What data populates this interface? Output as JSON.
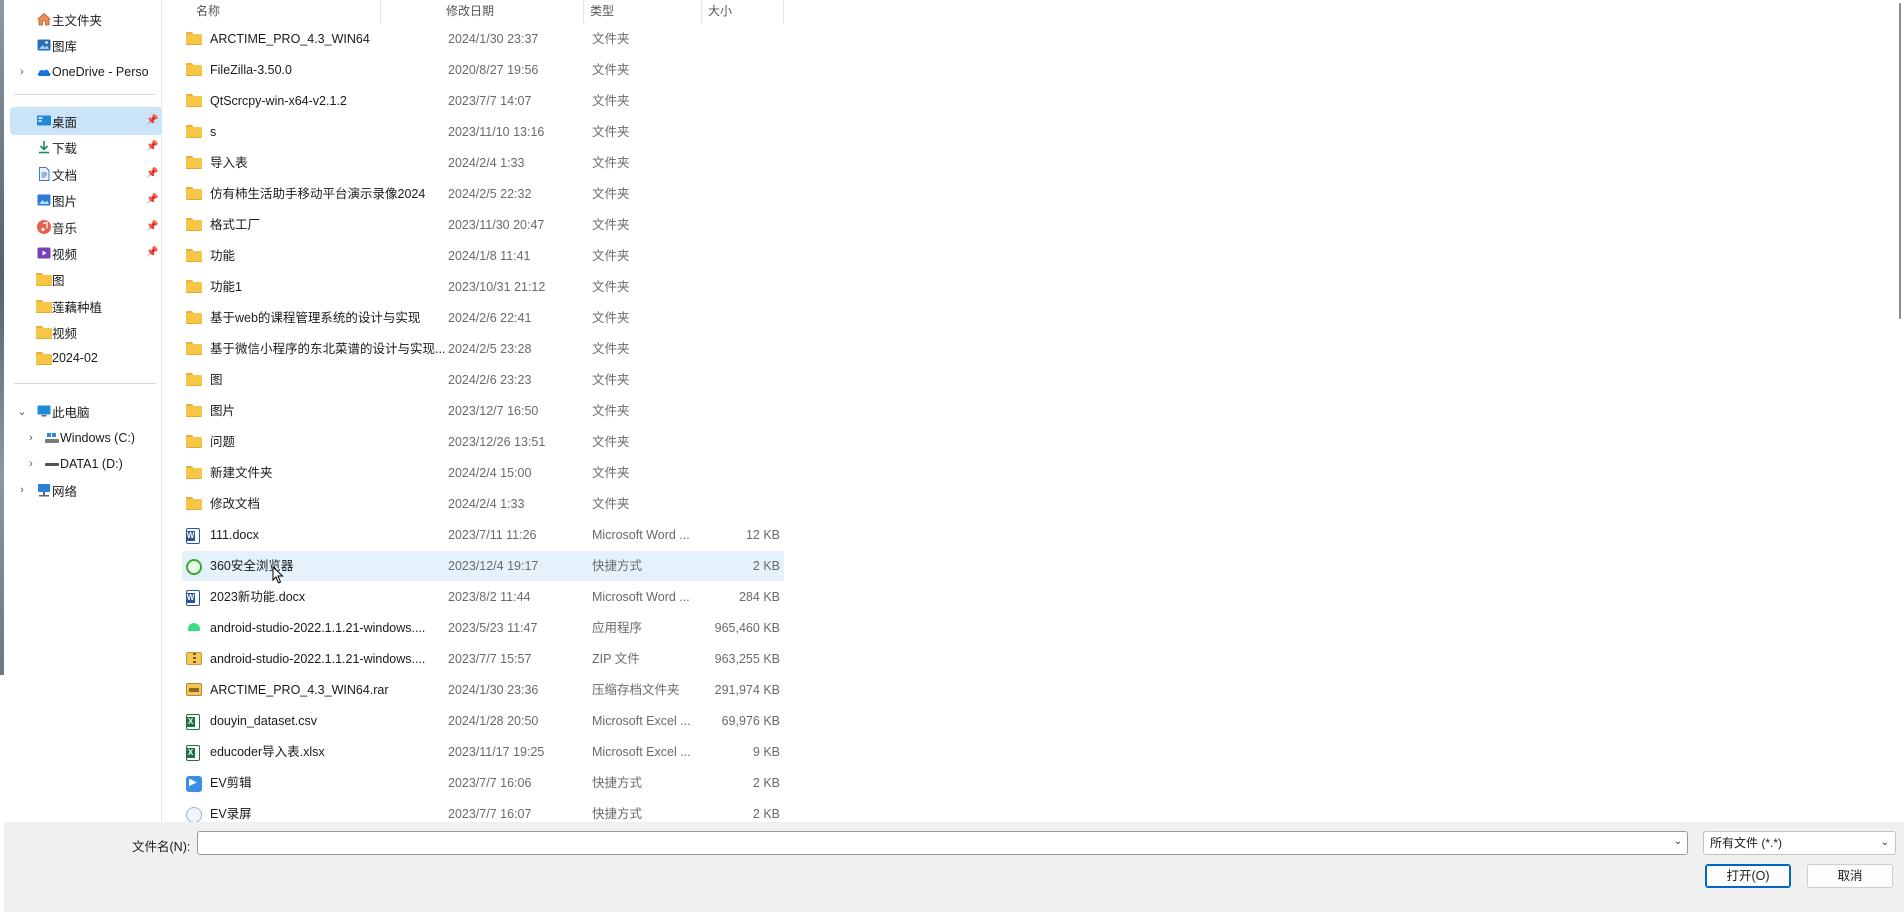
{
  "sidebar": {
    "items": [
      {
        "label": "主文件夹",
        "icon": "home-icon",
        "pinned": false
      },
      {
        "label": "图库",
        "icon": "gallery-icon",
        "pinned": false
      },
      {
        "label": "OneDrive - Perso",
        "icon": "onedrive-cloud-icon",
        "pinned": false,
        "expandable": true
      },
      {
        "label": "桌面",
        "icon": "desktop-icon",
        "pinned": true,
        "selected": true
      },
      {
        "label": "下载",
        "icon": "download-icon",
        "pinned": true
      },
      {
        "label": "文档",
        "icon": "documents-icon",
        "pinned": true
      },
      {
        "label": "图片",
        "icon": "pictures-icon",
        "pinned": true
      },
      {
        "label": "音乐",
        "icon": "music-icon",
        "pinned": true
      },
      {
        "label": "视频",
        "icon": "videos-icon",
        "pinned": true
      },
      {
        "label": "图",
        "icon": "folder-icon",
        "pinned": false
      },
      {
        "label": "莲藕种植",
        "icon": "folder-icon",
        "pinned": false
      },
      {
        "label": "视频",
        "icon": "folder-icon",
        "pinned": false
      },
      {
        "label": "2024-02",
        "icon": "folder-icon",
        "pinned": false
      },
      {
        "label": "此电脑",
        "icon": "this-pc-icon",
        "expanded": true
      },
      {
        "label": "Windows (C:)",
        "icon": "drive-c-icon",
        "expandable": true
      },
      {
        "label": "DATA1 (D:)",
        "icon": "drive-d-icon",
        "expandable": true
      },
      {
        "label": "网络",
        "icon": "network-icon",
        "expandable": true
      }
    ]
  },
  "columns": {
    "name": "名称",
    "modified": "修改日期",
    "type": "类型",
    "size": "大小"
  },
  "files": [
    {
      "name": "ARCTIME_PRO_4.3_WIN64",
      "date": "2024/1/30 23:37",
      "type": "文件夹",
      "size": "",
      "icon": "folder-icon"
    },
    {
      "name": "FileZilla-3.50.0",
      "date": "2020/8/27 19:56",
      "type": "文件夹",
      "size": "",
      "icon": "folder-icon"
    },
    {
      "name": "QtScrcpy-win-x64-v2.1.2",
      "date": "2023/7/7 14:07",
      "type": "文件夹",
      "size": "",
      "icon": "folder-icon"
    },
    {
      "name": "s",
      "date": "2023/11/10 13:16",
      "type": "文件夹",
      "size": "",
      "icon": "folder-icon"
    },
    {
      "name": "导入表",
      "date": "2024/2/4 1:33",
      "type": "文件夹",
      "size": "",
      "icon": "folder-icon"
    },
    {
      "name": "仿有柿生活助手移动平台演示录像2024",
      "date": "2024/2/5 22:32",
      "type": "文件夹",
      "size": "",
      "icon": "folder-icon"
    },
    {
      "name": "格式工厂",
      "date": "2023/11/30 20:47",
      "type": "文件夹",
      "size": "",
      "icon": "folder-icon"
    },
    {
      "name": "功能",
      "date": "2024/1/8 11:41",
      "type": "文件夹",
      "size": "",
      "icon": "folder-icon"
    },
    {
      "name": "功能1",
      "date": "2023/10/31 21:12",
      "type": "文件夹",
      "size": "",
      "icon": "folder-icon"
    },
    {
      "name": "基于web的课程管理系统的设计与实现",
      "date": "2024/2/6 22:41",
      "type": "文件夹",
      "size": "",
      "icon": "folder-icon"
    },
    {
      "name": "基于微信小程序的东北菜谱的设计与实现...",
      "date": "2024/2/5 23:28",
      "type": "文件夹",
      "size": "",
      "icon": "folder-icon"
    },
    {
      "name": "图",
      "date": "2024/2/6 23:23",
      "type": "文件夹",
      "size": "",
      "icon": "folder-icon"
    },
    {
      "name": "图片",
      "date": "2023/12/7 16:50",
      "type": "文件夹",
      "size": "",
      "icon": "folder-icon"
    },
    {
      "name": "问题",
      "date": "2023/12/26 13:51",
      "type": "文件夹",
      "size": "",
      "icon": "folder-icon"
    },
    {
      "name": "新建文件夹",
      "date": "2024/2/4 15:00",
      "type": "文件夹",
      "size": "",
      "icon": "folder-icon"
    },
    {
      "name": "修改文档",
      "date": "2024/2/4 1:33",
      "type": "文件夹",
      "size": "",
      "icon": "folder-icon"
    },
    {
      "name": "111.docx",
      "date": "2023/7/11 11:26",
      "type": "Microsoft Word ...",
      "size": "12 KB",
      "icon": "word-doc-icon"
    },
    {
      "name": "360安全浏览器",
      "date": "2023/12/4 19:17",
      "type": "快捷方式",
      "size": "2 KB",
      "icon": "browser-360-icon",
      "hover": true
    },
    {
      "name": "2023新功能.docx",
      "date": "2023/8/2 11:44",
      "type": "Microsoft Word ...",
      "size": "284 KB",
      "icon": "word-doc-icon"
    },
    {
      "name": "android-studio-2022.1.1.21-windows....",
      "date": "2023/5/23 11:47",
      "type": "应用程序",
      "size": "965,460 KB",
      "icon": "android-studio-icon"
    },
    {
      "name": "android-studio-2022.1.1.21-windows....",
      "date": "2023/7/7 15:57",
      "type": "ZIP 文件",
      "size": "963,255 KB",
      "icon": "zip-archive-icon"
    },
    {
      "name": "ARCTIME_PRO_4.3_WIN64.rar",
      "date": "2024/1/30 23:36",
      "type": "压缩存档文件夹",
      "size": "291,974 KB",
      "icon": "rar-archive-icon"
    },
    {
      "name": "douyin_dataset.csv",
      "date": "2024/1/28 20:50",
      "type": "Microsoft Excel ...",
      "size": "69,976 KB",
      "icon": "excel-csv-icon"
    },
    {
      "name": "educoder导入表.xlsx",
      "date": "2023/11/17 19:25",
      "type": "Microsoft Excel ...",
      "size": "9 KB",
      "icon": "excel-xlsx-icon"
    },
    {
      "name": "EV剪辑",
      "date": "2023/7/7 16:06",
      "type": "快捷方式",
      "size": "2 KB",
      "icon": "ev-editor-icon"
    },
    {
      "name": "EV录屏",
      "date": "2023/7/7 16:07",
      "type": "快捷方式",
      "size": "2 KB",
      "icon": "ev-recorder-icon"
    }
  ],
  "bottom": {
    "filename_label": "文件名(N):",
    "filename_value": "",
    "filetype_value": "所有文件 (*.*)",
    "open_label": "打开(O)",
    "cancel_label": "取消"
  },
  "colors": {
    "selected_bg": "#cce4f7",
    "hover_bg": "#e5f1fb",
    "accent": "#0067c0",
    "folder": "#f6c646"
  }
}
